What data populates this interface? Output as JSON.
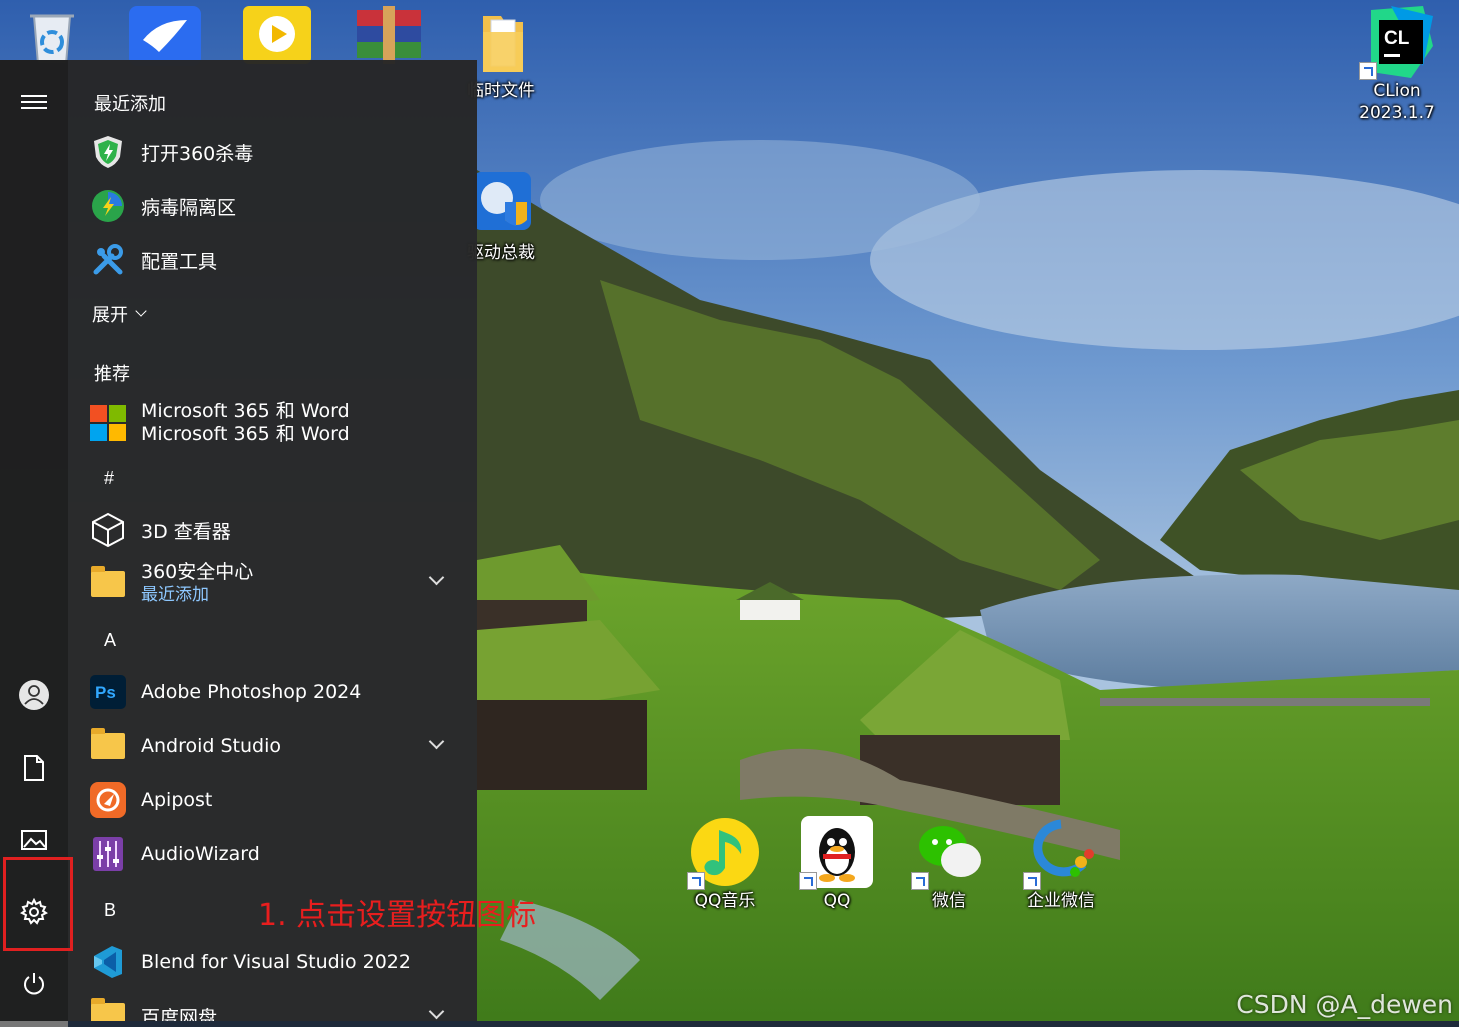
{
  "desktop": {
    "icons": [
      {
        "label": "",
        "icon": "recycle-bin-icon"
      },
      {
        "label": "",
        "icon": "feishu-icon"
      },
      {
        "label": "",
        "icon": "video-player-icon"
      },
      {
        "label": "",
        "icon": "winrar-icon"
      },
      {
        "label": "临时文件",
        "icon": "folder-icon"
      },
      {
        "label": "驱动总裁",
        "icon": "driver-tool-icon"
      },
      {
        "label": "CLion\n2023.1.7",
        "label_line1": "CLion",
        "label_line2": "2023.1.7",
        "icon": "clion-icon"
      },
      {
        "label": "QQ音乐",
        "icon": "qq-music-icon"
      },
      {
        "label": "QQ",
        "icon": "qq-icon"
      },
      {
        "label": "微信",
        "icon": "wechat-icon"
      },
      {
        "label": "企业微信",
        "icon": "wecom-icon"
      }
    ]
  },
  "start_menu": {
    "rail": {
      "menu_icon": "hamburger-icon",
      "user_icon": "user-icon",
      "documents_icon": "document-icon",
      "pictures_icon": "pictures-icon",
      "settings_icon": "gear-icon",
      "power_icon": "power-icon"
    },
    "recently_added": {
      "header": "最近添加",
      "items": [
        {
          "label": "打开360杀毒",
          "icon": "shield-icon"
        },
        {
          "label": "病毒隔离区",
          "icon": "quarantine-icon"
        },
        {
          "label": "配置工具",
          "icon": "tools-icon"
        }
      ],
      "expand_label": "展开"
    },
    "recommended": {
      "header": "推荐",
      "item_line1": "Microsoft 365 和 Word",
      "item_line2": "Microsoft 365 和 Word"
    },
    "groups": [
      {
        "letter": "#"
      },
      {
        "letter": "A"
      },
      {
        "letter": "B"
      }
    ],
    "apps": {
      "viewer_3d": "3D 查看器",
      "sec360": "360安全中心",
      "sec360_sub": "最近添加",
      "photoshop": "Adobe Photoshop 2024",
      "photoshop_badge": "Ps",
      "android_studio": "Android Studio",
      "apipost": "Apipost",
      "audiowizard": "AudioWizard",
      "blend": "Blend for Visual Studio 2022",
      "baidu": "百度网盘"
    }
  },
  "annotation": "1. 点击设置按钮图标",
  "watermark": "CSDN @A_dewen",
  "colors": {
    "menu_bg": "#262626",
    "rail_bg": "#202020",
    "annotation_red": "#e81e1e",
    "sub_label_blue": "#8ec8ff"
  }
}
